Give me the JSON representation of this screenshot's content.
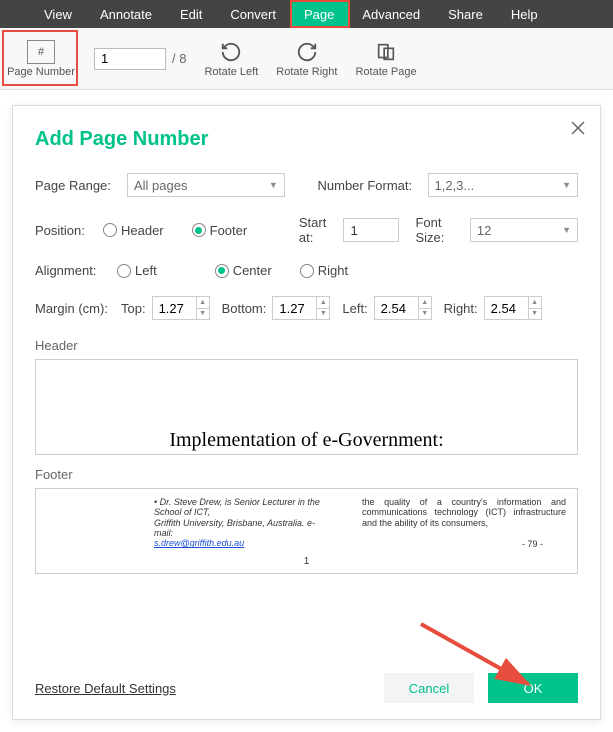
{
  "menu": {
    "items": [
      "View",
      "Annotate",
      "Edit",
      "Convert",
      "Page",
      "Advanced",
      "Share",
      "Help"
    ],
    "active_index": 4
  },
  "toolbar": {
    "page_number_label": "Page Number",
    "page_input_value": "1",
    "page_total": "/ 8",
    "rotate_left": "Rotate Left",
    "rotate_right": "Rotate Right",
    "rotate_page": "Rotate Page"
  },
  "dialog": {
    "title": "Add Page Number",
    "page_range_label": "Page Range:",
    "page_range_value": "All pages",
    "number_format_label": "Number Format:",
    "number_format_value": "1,2,3...",
    "position_label": "Position:",
    "position_header": "Header",
    "position_footer": "Footer",
    "position_selected": "Footer",
    "start_at_label": "Start at:",
    "start_at_value": "1",
    "font_size_label": "Font Size:",
    "font_size_value": "12",
    "alignment_label": "Alignment:",
    "alignment_left": "Left",
    "alignment_center": "Center",
    "alignment_right": "Right",
    "alignment_selected": "Center",
    "margin_label": "Margin (cm):",
    "margin_top_label": "Top:",
    "margin_top_value": "1.27",
    "margin_bottom_label": "Bottom:",
    "margin_bottom_value": "1.27",
    "margin_left_label": "Left:",
    "margin_left_value": "2.54",
    "margin_right_label": "Right:",
    "margin_right_value": "2.54",
    "header_section": "Header",
    "header_doc_title": "Implementation of e-Government:",
    "footer_section": "Footer",
    "footer_left_line1": "Dr. Steve Drew, is Senior Lecturer in the School of ICT,",
    "footer_left_line2": "Griffith    University,    Brisbane,    Australia.    e-mail:",
    "footer_left_email": "s.drew@griffith.edu.au",
    "footer_right": "the quality of a country's information and communications technology (ICT) infrastructure and the ability of its consumers,",
    "footer_center_num": "1",
    "footer_right_num": "- 79 -",
    "restore": "Restore Default Settings",
    "cancel": "Cancel",
    "ok": "OK"
  }
}
